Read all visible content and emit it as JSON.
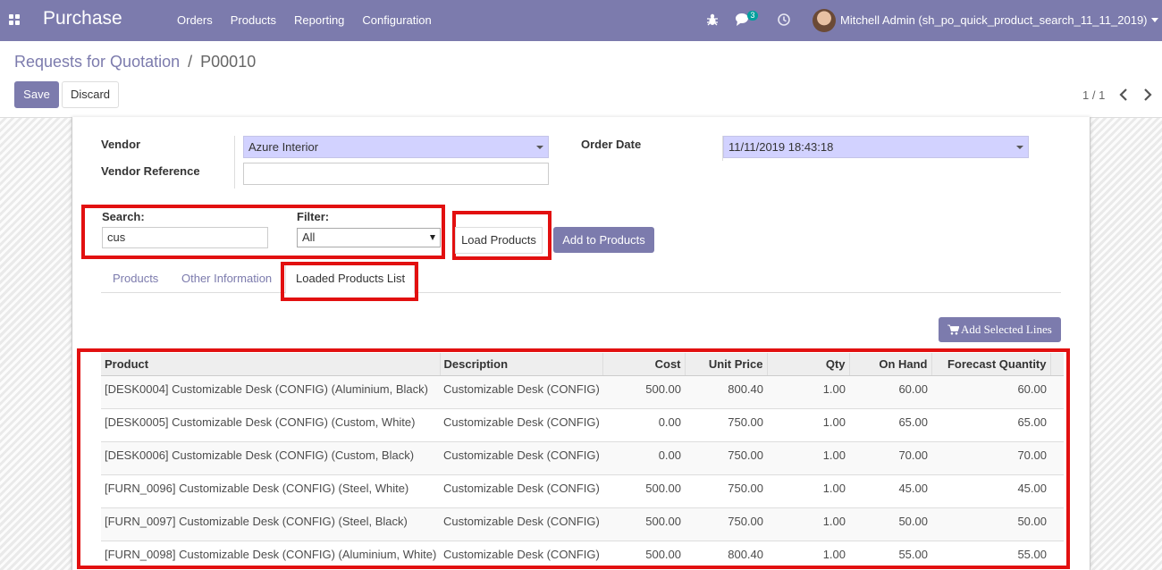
{
  "navbar": {
    "app_name": "Purchase",
    "menu": [
      "Orders",
      "Products",
      "Reporting",
      "Configuration"
    ],
    "chat_count": "3",
    "user": "Mitchell Admin (sh_po_quick_product_search_11_11_2019)"
  },
  "breadcrumb": {
    "parent": "Requests for Quotation",
    "separator": "/",
    "current": "P00010"
  },
  "buttons": {
    "save": "Save",
    "discard": "Discard",
    "load_products": "Load Products",
    "add_to_products": "Add to Products",
    "add_selected_lines": "Add Selected Lines"
  },
  "pager": {
    "value": "1 / 1"
  },
  "form": {
    "vendor_label": "Vendor",
    "vendor_value": "Azure Interior",
    "vendor_reference_label": "Vendor Reference",
    "vendor_reference_value": "",
    "order_date_label": "Order Date",
    "order_date_value": "11/11/2019 18:43:18",
    "search_label": "Search:",
    "search_value": "cus",
    "filter_label": "Filter:",
    "filter_value": "All"
  },
  "tabs": [
    "Products",
    "Other Information",
    "Loaded Products List"
  ],
  "table": {
    "columns": [
      "Product",
      "Description",
      "Cost",
      "Unit Price",
      "Qty",
      "On Hand",
      "Forecast Quantity"
    ],
    "rows": [
      [
        "[DESK0004] Customizable Desk (CONFIG) (Aluminium, Black)",
        "Customizable Desk (CONFIG)",
        "500.00",
        "800.40",
        "1.00",
        "60.00",
        "60.00"
      ],
      [
        "[DESK0005] Customizable Desk (CONFIG) (Custom, White)",
        "Customizable Desk (CONFIG)",
        "0.00",
        "750.00",
        "1.00",
        "65.00",
        "65.00"
      ],
      [
        "[DESK0006] Customizable Desk (CONFIG) (Custom, Black)",
        "Customizable Desk (CONFIG)",
        "0.00",
        "750.00",
        "1.00",
        "70.00",
        "70.00"
      ],
      [
        "[FURN_0096] Customizable Desk (CONFIG) (Steel, White)",
        "Customizable Desk (CONFIG)",
        "500.00",
        "750.00",
        "1.00",
        "45.00",
        "45.00"
      ],
      [
        "[FURN_0097] Customizable Desk (CONFIG) (Steel, Black)",
        "Customizable Desk (CONFIG)",
        "500.00",
        "750.00",
        "1.00",
        "50.00",
        "50.00"
      ],
      [
        "[FURN_0098] Customizable Desk (CONFIG) (Aluminium, White)",
        "Customizable Desk (CONFIG)",
        "500.00",
        "800.40",
        "1.00",
        "55.00",
        "55.00"
      ]
    ]
  },
  "colors": {
    "brand": "#7c7bad",
    "highlight_box": "#e21010",
    "required_field": "#d2d2ff"
  }
}
